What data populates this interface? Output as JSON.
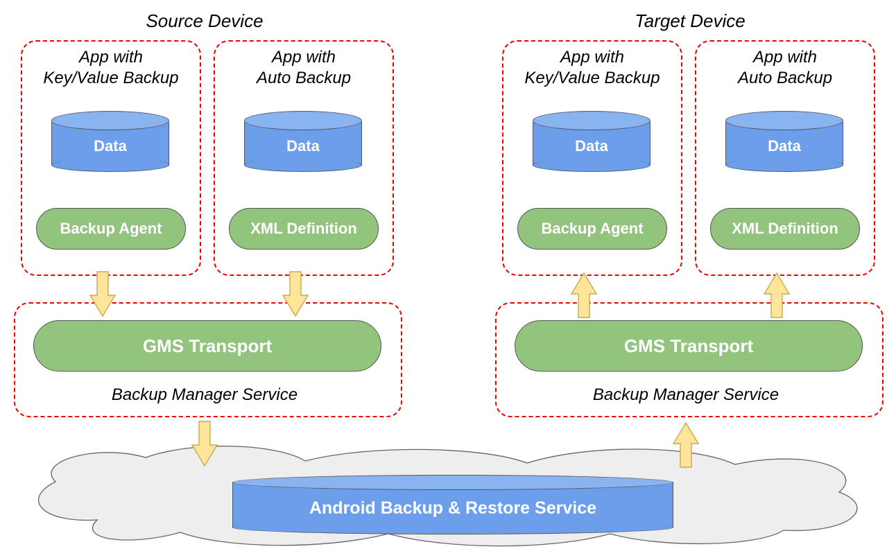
{
  "source": {
    "title": "Source Device",
    "appKV": {
      "title": "App with\nKey/Value Backup",
      "data": "Data",
      "agent": "Backup Agent"
    },
    "appAuto": {
      "title": "App with\nAuto Backup",
      "data": "Data",
      "agent": "XML Definition"
    },
    "transport": "GMS Transport",
    "bms": "Backup Manager Service"
  },
  "target": {
    "title": "Target Device",
    "appKV": {
      "title": "App with\nKey/Value Backup",
      "data": "Data",
      "agent": "Backup Agent"
    },
    "appAuto": {
      "title": "App with\nAuto Backup",
      "data": "Data",
      "agent": "XML Definition"
    },
    "transport": "GMS Transport",
    "bms": "Backup Manager Service"
  },
  "service": "Android Backup & Restore Service"
}
